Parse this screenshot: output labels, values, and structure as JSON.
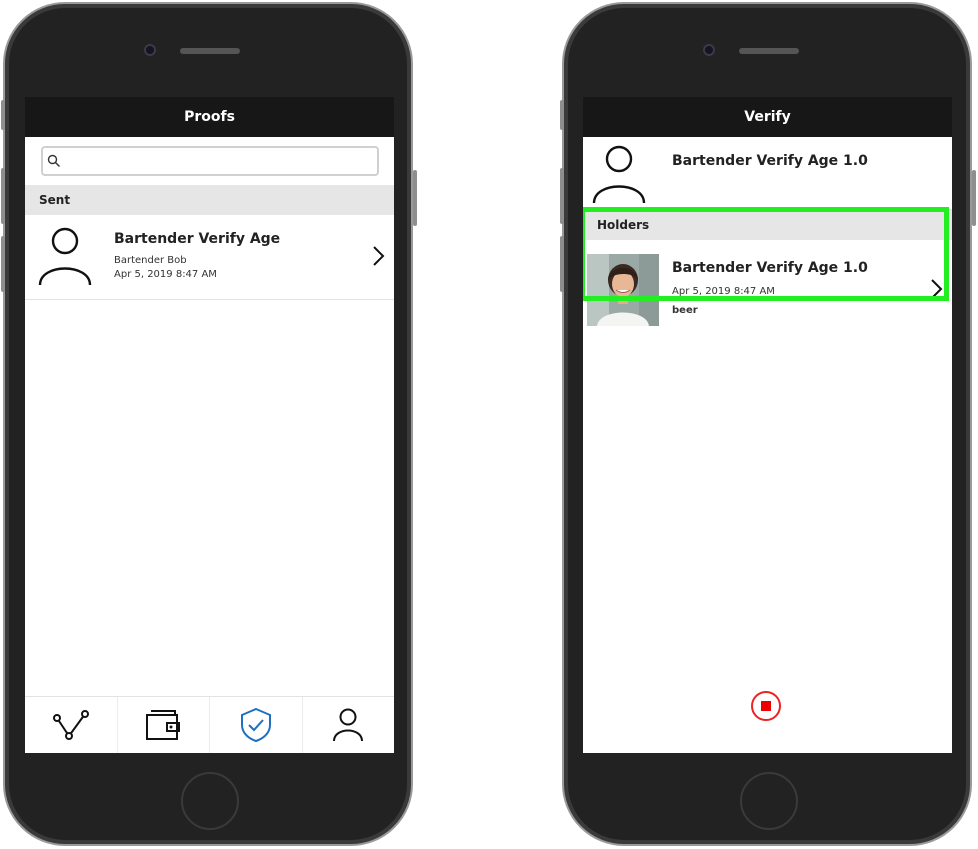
{
  "left_phone": {
    "header": {
      "title": "Proofs"
    },
    "search": {
      "placeholder": "",
      "value": ""
    },
    "section": {
      "label": "Sent"
    },
    "list": [
      {
        "title": "Bartender Verify Age",
        "subtitle": "Bartender Bob",
        "date": "Apr 5, 2019 8:47 AM"
      }
    ],
    "tabs": [
      {
        "icon": "connections-icon",
        "active": false
      },
      {
        "icon": "wallet-icon",
        "active": false
      },
      {
        "icon": "shield-check-icon",
        "active": true
      },
      {
        "icon": "profile-icon",
        "active": false
      }
    ]
  },
  "right_phone": {
    "header": {
      "title": "Verify"
    },
    "request": {
      "title": "Bartender Verify Age 1.0"
    },
    "section": {
      "label": "Holders"
    },
    "holders": [
      {
        "title": "Bartender Verify Age 1.0",
        "date": "Apr 5, 2019 8:47 AM",
        "tag": "beer"
      }
    ],
    "stop_button": {
      "icon": "stop-icon"
    }
  },
  "colors": {
    "header_bg": "#171717",
    "active_tab": "#1f70c1",
    "highlight": "#22ee22",
    "stop": "#e00000",
    "section_bg": "#e6e6e6"
  }
}
